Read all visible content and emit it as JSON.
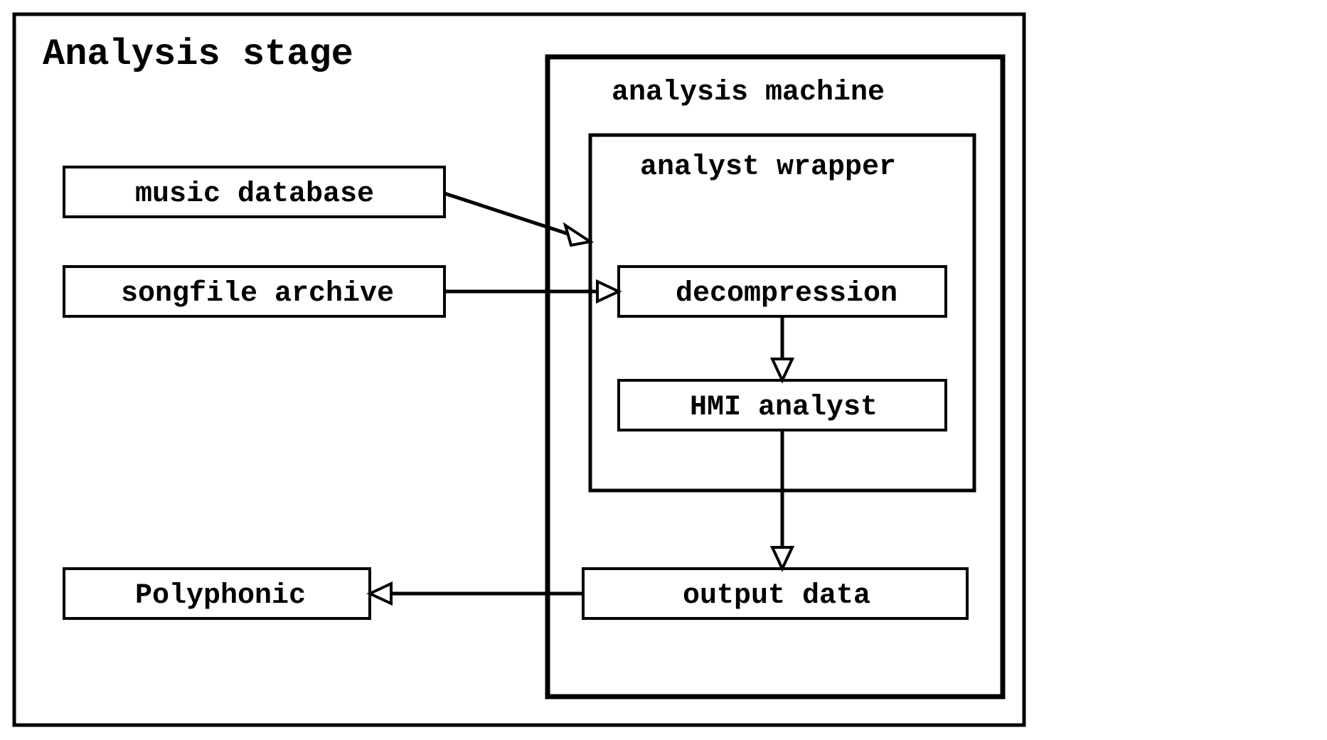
{
  "diagram": {
    "title": "Analysis stage",
    "analysis_machine": {
      "label": "analysis machine",
      "analyst_wrapper": {
        "label": "analyst wrapper",
        "decompression": "decompression",
        "hmi_analyst": "HMI analyst"
      },
      "output_data": "output data"
    },
    "left": {
      "music_database": "music database",
      "songfile_archive": "songfile archive",
      "polyphonic": "Polyphonic"
    },
    "edges": [
      {
        "from": "music_database",
        "to": "analyst_wrapper",
        "direction": "right"
      },
      {
        "from": "songfile_archive",
        "to": "decompression",
        "direction": "right"
      },
      {
        "from": "decompression",
        "to": "hmi_analyst",
        "direction": "down"
      },
      {
        "from": "hmi_analyst",
        "to": "output_data",
        "direction": "down"
      },
      {
        "from": "output_data",
        "to": "polyphonic",
        "direction": "left"
      }
    ]
  }
}
